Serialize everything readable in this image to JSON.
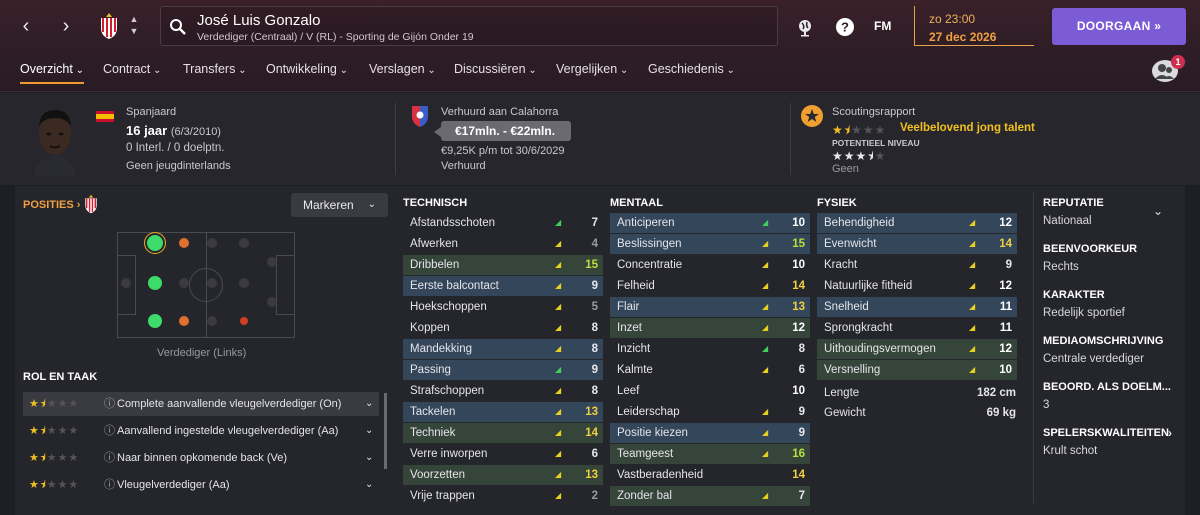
{
  "header": {
    "player_name": "José Luis Gonzalo",
    "player_sub": "Verdediger (Centraal) / V (RL) - Sporting de Gijón Onder 19",
    "fm_label": "FM",
    "time": "zo 23:00",
    "date": "27 dec 2026",
    "continue_label": "DOORGAAN",
    "notification_count": "1",
    "icons": [
      "back-arrow-icon",
      "forward-arrow-icon",
      "club-crest-icon",
      "search-icon",
      "globe-icon",
      "help-icon",
      "profile-icon"
    ]
  },
  "tabs": [
    {
      "label": "Overzicht"
    },
    {
      "label": "Contract"
    },
    {
      "label": "Transfers"
    },
    {
      "label": "Ontwikkeling"
    },
    {
      "label": "Verslagen"
    },
    {
      "label": "Discussiëren"
    },
    {
      "label": "Vergelijken"
    },
    {
      "label": "Geschiedenis"
    }
  ],
  "info": {
    "nationality": "Spanjaard",
    "age": "16 jaar",
    "dob": "(6/3/2010)",
    "caps": "0 Interl. / 0 doelptn.",
    "youth": "Geen jeugdinterlands",
    "loan_label": "Verhuurd aan Calahorra",
    "value": "€17mln. - €22mln.",
    "wage": "€9,25K p/m tot 30/6/2029",
    "status": "Verhuurd",
    "scout_label": "Scoutingsrapport",
    "scout_verdict": "Veelbelovend jong talent",
    "potential_label": "POTENTIEEL NIVEAU",
    "potential_value": "Geen",
    "current_stars": 1.5,
    "potential_stars": 3.5
  },
  "positions": {
    "heading": "POSITIES",
    "markeren_label": "Markeren",
    "position_label": "Verdediger (Links)"
  },
  "roles": {
    "heading": "ROL EN TAAK",
    "items": [
      {
        "label": "Complete aanvallende vleugelverdediger (On)",
        "stars": 1.5
      },
      {
        "label": "Aanvallend ingestelde vleugelverdediger (Aa)",
        "stars": 1.5
      },
      {
        "label": "Naar binnen opkomende back (Ve)",
        "stars": 1.5
      },
      {
        "label": "Vleugelverdediger (Aa)",
        "stars": 1.5
      }
    ]
  },
  "technical": {
    "heading": "TECHNISCH",
    "items": [
      {
        "name": "Afstandsschoten",
        "value": "7",
        "hl": "",
        "trend": "up-green"
      },
      {
        "name": "Afwerken",
        "value": "4",
        "hl": "",
        "trend": "up-yellow"
      },
      {
        "name": "Dribbelen",
        "value": "15",
        "hl": "green",
        "trend": "up-yellow"
      },
      {
        "name": "Eerste balcontact",
        "value": "9",
        "hl": "blue",
        "trend": "up-yellow"
      },
      {
        "name": "Hoekschoppen",
        "value": "5",
        "hl": "",
        "trend": "up-yellow"
      },
      {
        "name": "Koppen",
        "value": "8",
        "hl": "",
        "trend": "up-yellow"
      },
      {
        "name": "Mandekking",
        "value": "8",
        "hl": "blue",
        "trend": "up-yellow"
      },
      {
        "name": "Passing",
        "value": "9",
        "hl": "blue",
        "trend": "up-green"
      },
      {
        "name": "Strafschoppen",
        "value": "8",
        "hl": "",
        "trend": "up-yellow"
      },
      {
        "name": "Tackelen",
        "value": "13",
        "hl": "blue",
        "trend": "up-yellow"
      },
      {
        "name": "Techniek",
        "value": "14",
        "hl": "green",
        "trend": "up-yellow"
      },
      {
        "name": "Verre inworpen",
        "value": "6",
        "hl": "",
        "trend": "up-yellow"
      },
      {
        "name": "Voorzetten",
        "value": "13",
        "hl": "green",
        "trend": "up-yellow"
      },
      {
        "name": "Vrije trappen",
        "value": "2",
        "hl": "",
        "trend": "up-yellow"
      }
    ]
  },
  "mental": {
    "heading": "MENTAAL",
    "items": [
      {
        "name": "Anticiperen",
        "value": "10",
        "hl": "blue",
        "trend": "up-green"
      },
      {
        "name": "Beslissingen",
        "value": "15",
        "hl": "blue",
        "trend": "up-yellow"
      },
      {
        "name": "Concentratie",
        "value": "10",
        "hl": "",
        "trend": "up-yellow"
      },
      {
        "name": "Felheid",
        "value": "14",
        "hl": "",
        "trend": "up-yellow"
      },
      {
        "name": "Flair",
        "value": "13",
        "hl": "blue",
        "trend": "up-yellow"
      },
      {
        "name": "Inzet",
        "value": "12",
        "hl": "green",
        "trend": "up-yellow"
      },
      {
        "name": "Inzicht",
        "value": "8",
        "hl": "",
        "trend": "up-green"
      },
      {
        "name": "Kalmte",
        "value": "6",
        "hl": "",
        "trend": "up-yellow"
      },
      {
        "name": "Leef",
        "value": "10",
        "hl": "",
        "trend": "none"
      },
      {
        "name": "Leiderschap",
        "value": "9",
        "hl": "",
        "trend": "up-yellow"
      },
      {
        "name": "Positie kiezen",
        "value": "9",
        "hl": "blue",
        "trend": "up-yellow"
      },
      {
        "name": "Teamgeest",
        "value": "16",
        "hl": "green",
        "trend": "up-yellow"
      },
      {
        "name": "Vastberadenheid",
        "value": "14",
        "hl": "",
        "trend": "none"
      },
      {
        "name": "Zonder bal",
        "value": "7",
        "hl": "green",
        "trend": "up-yellow"
      }
    ]
  },
  "physical": {
    "heading": "FYSIEK",
    "items": [
      {
        "name": "Behendigheid",
        "value": "12",
        "hl": "blue",
        "trend": "up-yellow"
      },
      {
        "name": "Evenwicht",
        "value": "14",
        "hl": "blue",
        "trend": "up-yellow"
      },
      {
        "name": "Kracht",
        "value": "9",
        "hl": "",
        "trend": "up-yellow"
      },
      {
        "name": "Natuurlijke fitheid",
        "value": "12",
        "hl": "",
        "trend": "up-yellow"
      },
      {
        "name": "Snelheid",
        "value": "11",
        "hl": "blue",
        "trend": "up-yellow"
      },
      {
        "name": "Sprongkracht",
        "value": "11",
        "hl": "",
        "trend": "up-yellow"
      },
      {
        "name": "Uithoudingsvermogen",
        "value": "12",
        "hl": "green",
        "trend": "up-yellow"
      },
      {
        "name": "Versnelling",
        "value": "10",
        "hl": "green",
        "trend": "up-yellow"
      }
    ],
    "height_label": "Lengte",
    "height_value": "182 cm",
    "weight_label": "Gewicht",
    "weight_value": "69 kg"
  },
  "right": {
    "items": [
      {
        "heading": "REPUTATIE",
        "value": "Nationaal"
      },
      {
        "heading": "BEENVOORKEUR",
        "value": "Rechts"
      },
      {
        "heading": "KARAKTER",
        "value": "Redelijk sportief"
      },
      {
        "heading": "MEDIAOMSCHRIJVING",
        "value": "Centrale verdediger"
      },
      {
        "heading": "BEOORD. ALS DOELM...",
        "value": "3"
      },
      {
        "heading": "SPELERSKWALITEITEN",
        "value": "Krult schot"
      }
    ]
  },
  "colors": {
    "accent": "#f09a30",
    "continue": "#7b5bd6",
    "high": "#f0d040",
    "mid": "#ffffff"
  }
}
